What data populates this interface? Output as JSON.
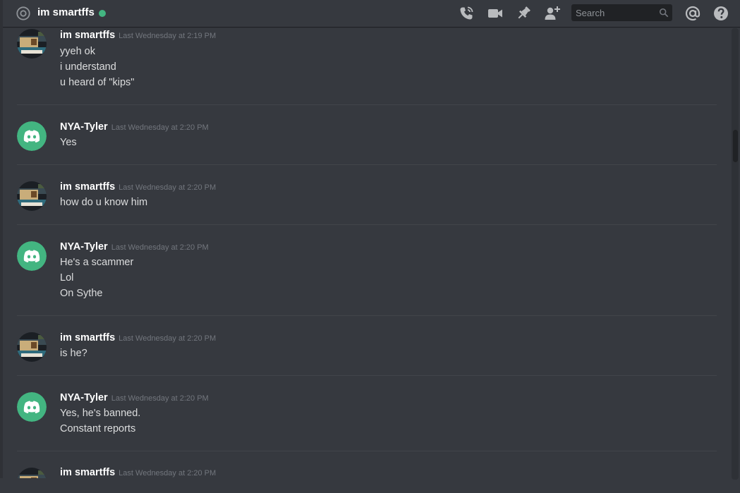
{
  "header": {
    "channel_name": "im smartffs",
    "search_placeholder": "Search",
    "icons": [
      "at-icon",
      "call-icon",
      "video-icon",
      "pin-icon",
      "add-friend-icon",
      "search-icon",
      "mentions-icon",
      "help-icon"
    ]
  },
  "colors": {
    "background": "#36393f",
    "online": "#43b581",
    "discord_avatar": "#43b581",
    "header_text": "#ffffff",
    "timestamp": "#72767d"
  },
  "messages": [
    {
      "author": "im smartffs",
      "timestamp": "Last Wednesday at 2:19 PM",
      "avatar": "custom",
      "lines": [
        "yyeh ok",
        "i understand",
        "u heard of \"kips\""
      ]
    },
    {
      "author": "NYA-Tyler",
      "timestamp": "Last Wednesday at 2:20 PM",
      "avatar": "discord",
      "lines": [
        "Yes"
      ]
    },
    {
      "author": "im smartffs",
      "timestamp": "Last Wednesday at 2:20 PM",
      "avatar": "custom",
      "lines": [
        "how do u know him"
      ]
    },
    {
      "author": "NYA-Tyler",
      "timestamp": "Last Wednesday at 2:20 PM",
      "avatar": "discord",
      "lines": [
        "He's a scammer",
        "Lol",
        "On Sythe"
      ]
    },
    {
      "author": "im smartffs",
      "timestamp": "Last Wednesday at 2:20 PM",
      "avatar": "custom",
      "lines": [
        "is he?"
      ]
    },
    {
      "author": "NYA-Tyler",
      "timestamp": "Last Wednesday at 2:20 PM",
      "avatar": "discord",
      "lines": [
        "Yes, he's banned.",
        "Constant reports"
      ]
    },
    {
      "author": "im smartffs",
      "timestamp": "Last Wednesday at 2:20 PM",
      "avatar": "custom",
      "lines": []
    }
  ]
}
